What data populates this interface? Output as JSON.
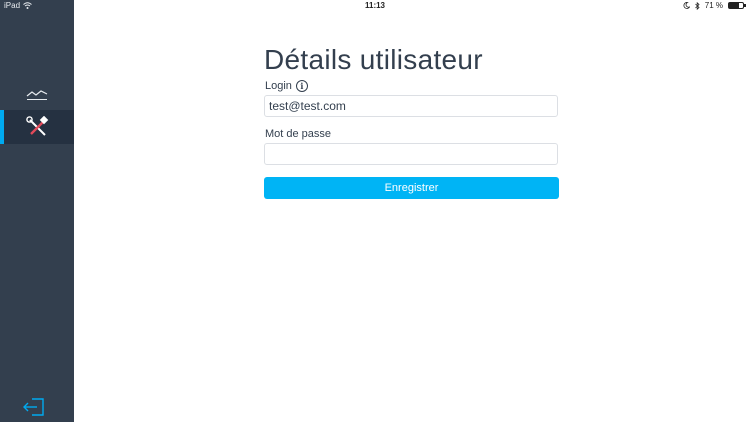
{
  "status_bar": {
    "device": "iPad",
    "time": "11:13",
    "battery": "71 %",
    "battery_level": 0.71,
    "icons": [
      "wifi-icon",
      "moon-icon",
      "bluetooth-icon",
      "battery-icon"
    ]
  },
  "sidebar": {
    "background": "#333f4e",
    "active_color": "#00aaf0",
    "items": [
      {
        "name": "statistics",
        "icon": "line-chart-icon",
        "active": false
      },
      {
        "name": "tools",
        "icon": "hammer-wrench-icon",
        "active": true
      }
    ],
    "footer_icon": "logout-icon"
  },
  "main": {
    "title": "Détails utilisateur",
    "login_label": "Login",
    "login_value": "test@test.com",
    "password_label": "Mot de passe",
    "password_value": "",
    "save_label": "Enregistrer",
    "accent": "#00b4f5"
  }
}
